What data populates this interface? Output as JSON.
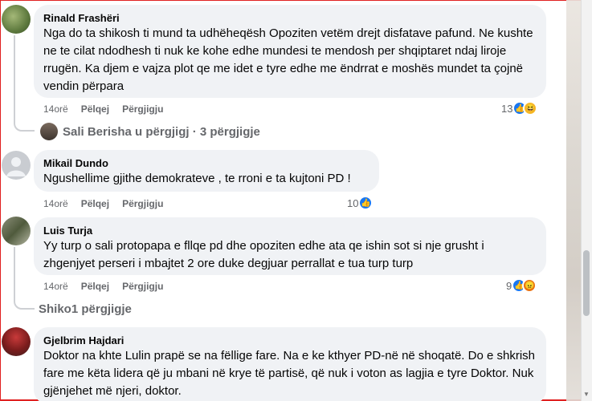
{
  "comments": [
    {
      "author": "Rinald Frashëri",
      "text": "Nga do ta shikosh ti mund ta udhëheqësh Opoziten vetëm drejt disfatave pafund. Ne kushte ne te cilat ndodhesh ti nuk ke kohe edhe mundesi te mendosh per shqiptaret ndaj liroje rrugën. Ka djem e vajza plot qe me idet e tyre edhe me ëndrrat e moshës mundet ta çojnë vendin përpara",
      "time": "14orë",
      "like_label": "Pëlqej",
      "reply_label": "Përgjigju",
      "reaction_count": "13"
    },
    {
      "author": "Mikail Dundo",
      "text": "Ngushellime gjithe demokrateve , te rroni e ta kujtoni PD !",
      "time": "14orë",
      "like_label": "Pëlqej",
      "reply_label": "Përgjigju",
      "reaction_count": "10"
    },
    {
      "author": "Luis Turja",
      "text": "Yy turp o sali protopapa e fllqe pd dhe opoziten edhe ata qe ishin sot si nje grusht i zhgenjyet perseri i mbajtet 2 ore duke degjuar perrallat e tua turp turp",
      "time": "14orë",
      "like_label": "Pëlqej",
      "reply_label": "Përgjigju",
      "reaction_count": "9"
    },
    {
      "author": "Gjelbrim Hajdari",
      "text": "Doktor na khte Lulin prapë se na fëllige fare. Na e ke kthyer PD-në në shoqatë. Do e shkrish fare me këta lidera që ju mbani në krye të partisë, që nuk i voton as lagjia e tyre Doktor. Nuk gjënjehet më njeri, doktor."
    }
  ],
  "replies": {
    "first": "Sali Berisha u përgjigj · 3 përgjigje",
    "second": "Shiko1 përgjigje"
  }
}
